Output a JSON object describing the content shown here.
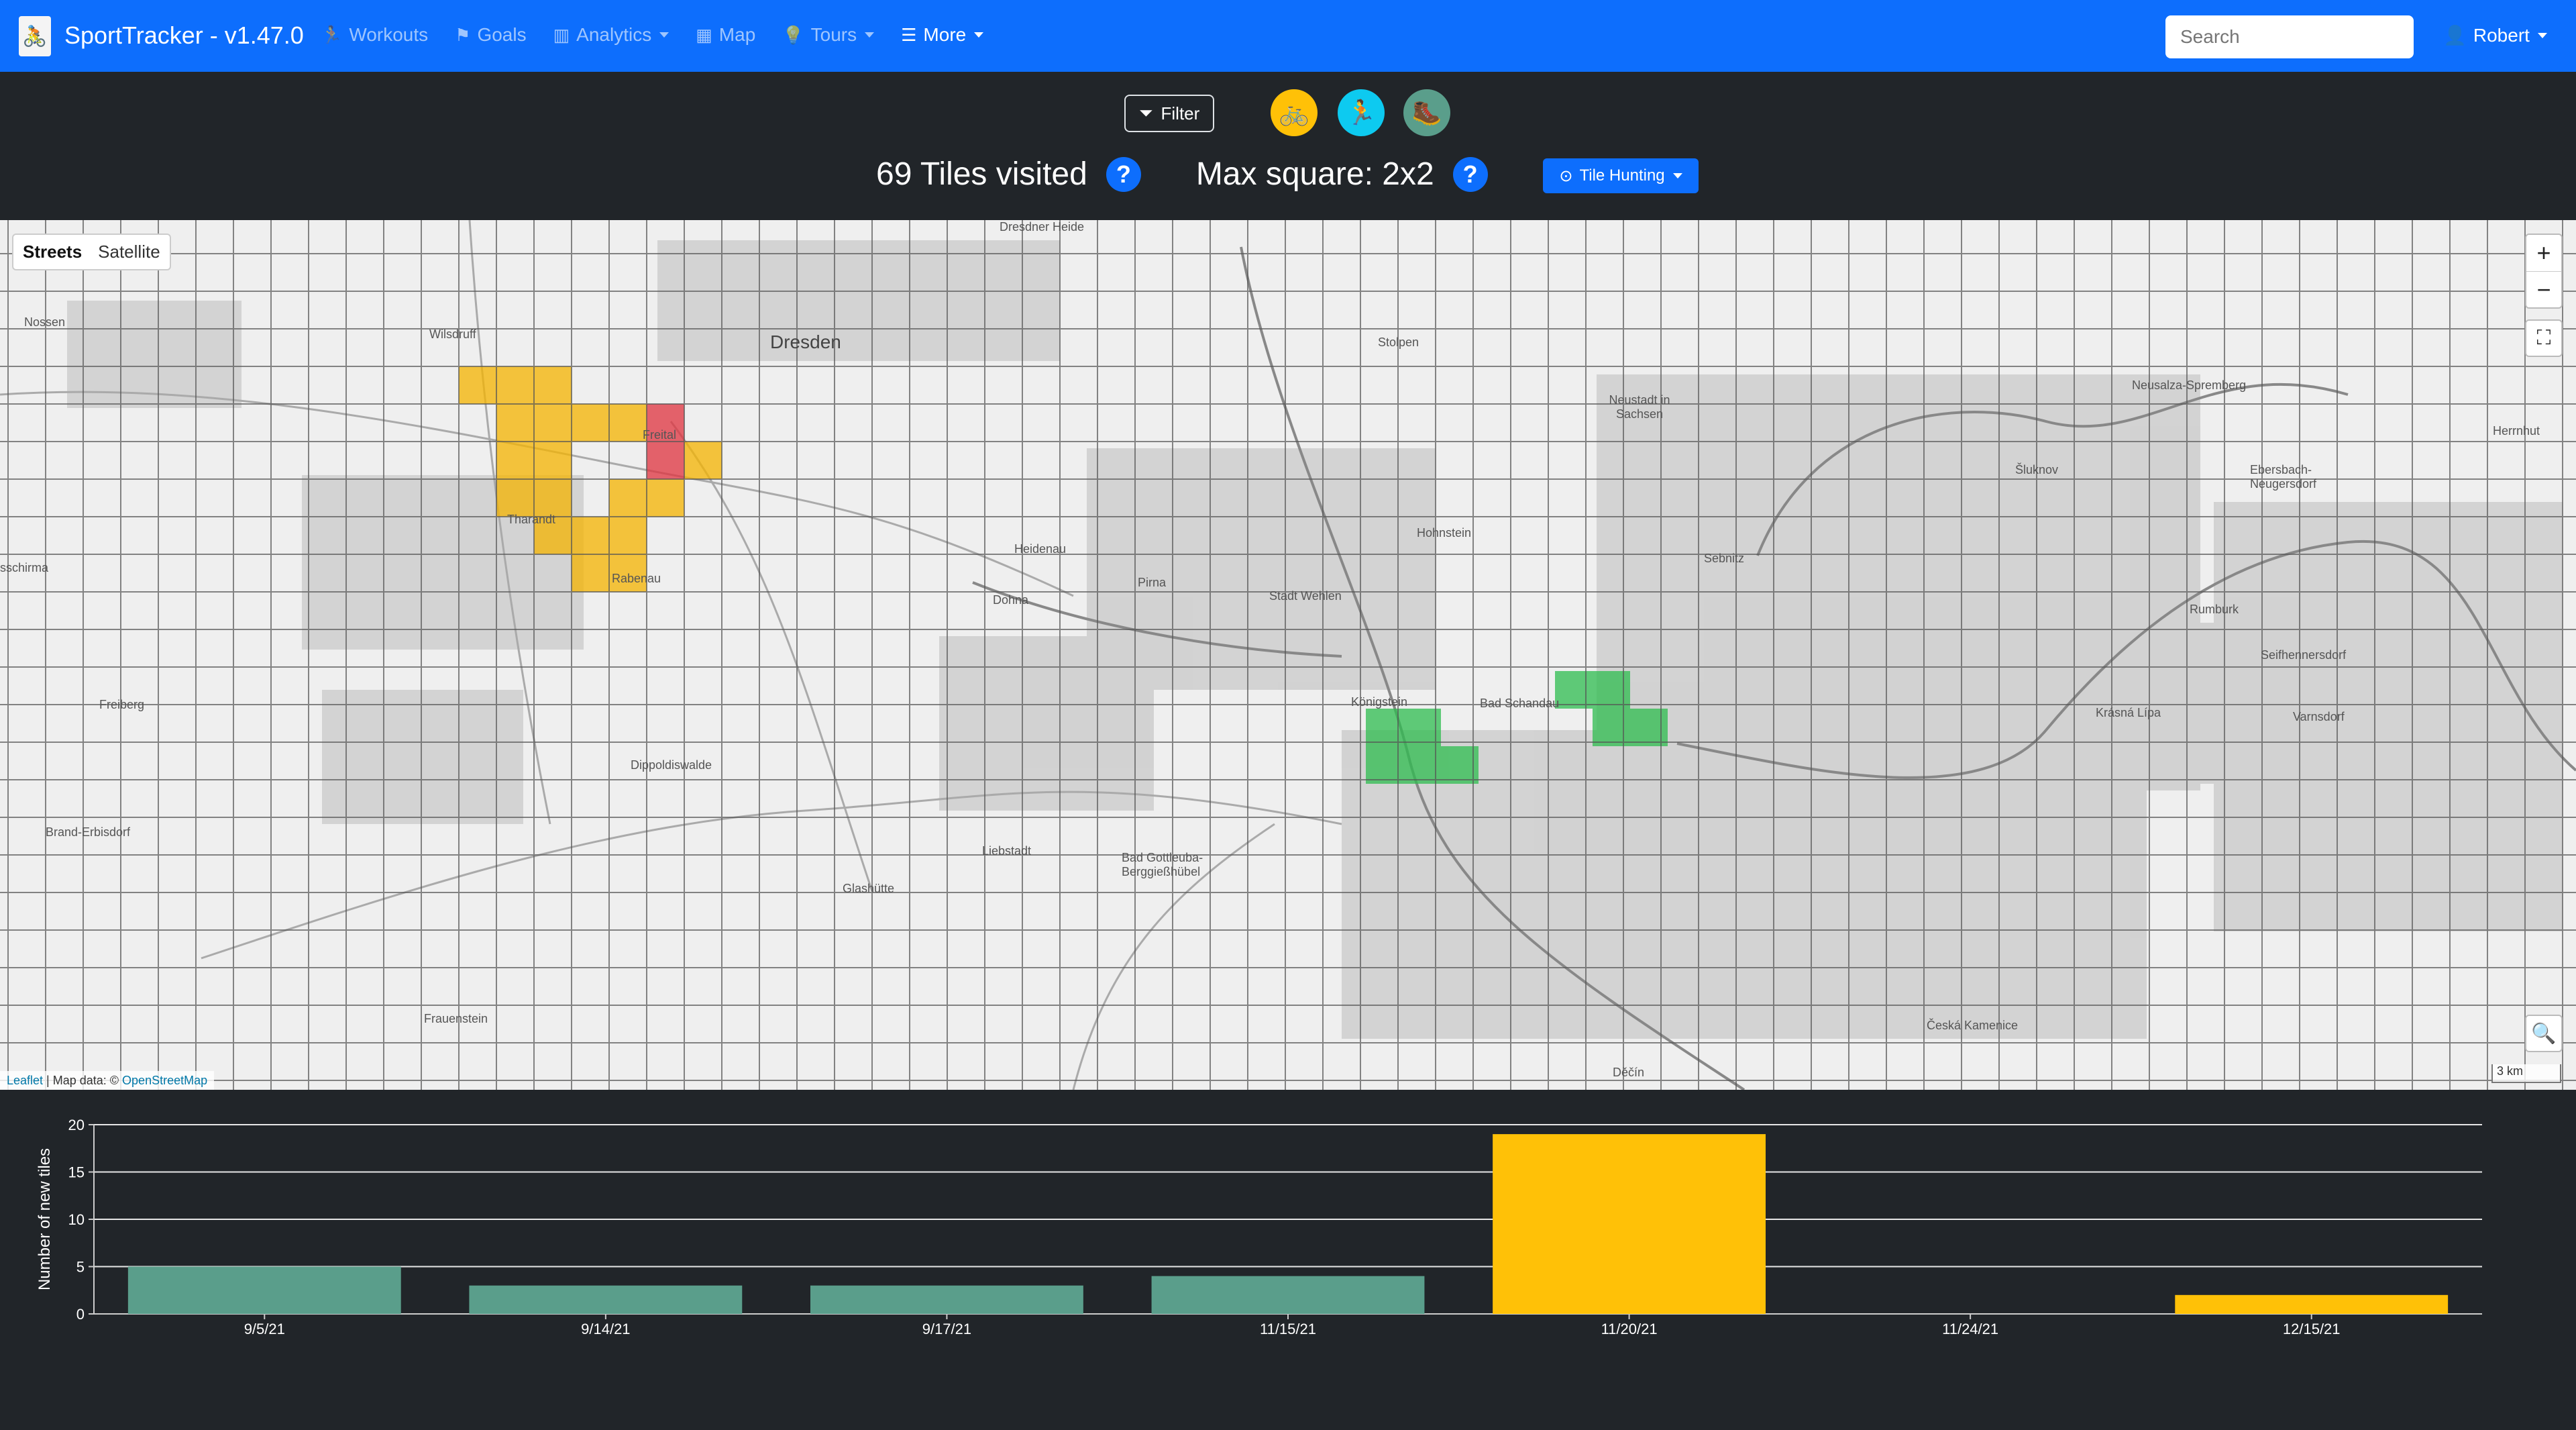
{
  "navbar": {
    "brand": "SportTracker - v1.47.0",
    "items": [
      {
        "label": "Workouts",
        "icon": "running-icon"
      },
      {
        "label": "Goals",
        "icon": "flag-icon"
      },
      {
        "label": "Analytics",
        "icon": "bar-chart-icon",
        "dropdown": true
      },
      {
        "label": "Map",
        "icon": "map-icon"
      },
      {
        "label": "Tours",
        "icon": "lightbulb-icon",
        "dropdown": true
      },
      {
        "label": "More",
        "icon": "list-icon",
        "dropdown": true
      }
    ],
    "search_placeholder": "Search",
    "user": "Robert"
  },
  "controls": {
    "filter_label": "Filter",
    "sports": [
      {
        "name": "cycling",
        "color": "#ffc107"
      },
      {
        "name": "running",
        "color": "#0dcaf0"
      },
      {
        "name": "hiking",
        "color": "#5a9e8b"
      }
    ],
    "tiles_visited": "69 Tiles visited",
    "max_square": "Max square: 2x2",
    "help": "?",
    "tile_hunting_label": "Tile Hunting"
  },
  "map": {
    "layers": {
      "streets": "Streets",
      "satellite": "Satellite"
    },
    "zoom_in": "+",
    "zoom_out": "−",
    "scale": "3 km",
    "attribution_leaflet": "Leaflet",
    "attribution_text": " | Map data: © ",
    "attribution_osm": "OpenStreetMap",
    "places": [
      {
        "name": "Dresden",
        "city": true
      },
      {
        "name": "Dresdner Heide"
      },
      {
        "name": "Nossen"
      },
      {
        "name": "Wilsdruff"
      },
      {
        "name": "Freital"
      },
      {
        "name": "Tharandt"
      },
      {
        "name": "Rabenau"
      },
      {
        "name": "Heidenau"
      },
      {
        "name": "Pirna"
      },
      {
        "name": "Dohna"
      },
      {
        "name": "Stolpen"
      },
      {
        "name": "Neustadt in Sachsen"
      },
      {
        "name": "Hohnstein"
      },
      {
        "name": "Stadt Wehlen"
      },
      {
        "name": "Sebnitz"
      },
      {
        "name": "Königstein"
      },
      {
        "name": "Bad Schandau"
      },
      {
        "name": "Freiberg"
      },
      {
        "name": "Dippoldiswalde"
      },
      {
        "name": "Brand-Erbisdorf"
      },
      {
        "name": "Liebstadt"
      },
      {
        "name": "Bad Gottleuba-Berggießhübel"
      },
      {
        "name": "Glashütte"
      },
      {
        "name": "Frauenstein"
      },
      {
        "name": "Neusalza-Spremberg"
      },
      {
        "name": "Šluknov"
      },
      {
        "name": "Ebersbach-Neugersdorf"
      },
      {
        "name": "Rumburk"
      },
      {
        "name": "Seifhennersdorf"
      },
      {
        "name": "Krásná Lípa"
      },
      {
        "name": "Varnsdorf"
      },
      {
        "name": "Česká Kamenice"
      },
      {
        "name": "Děčín"
      },
      {
        "name": "Herrnhut"
      },
      {
        "name": "sschirma"
      }
    ]
  },
  "chart_data": {
    "type": "bar",
    "categories": [
      "9/5/21",
      "9/14/21",
      "9/17/21",
      "11/15/21",
      "11/20/21",
      "11/24/21",
      "12/15/21"
    ],
    "values": [
      5,
      3,
      3,
      4,
      19,
      0,
      2
    ],
    "colors": [
      "#5a9e8b",
      "#5a9e8b",
      "#5a9e8b",
      "#5a9e8b",
      "#ffc107",
      "#5a9e8b",
      "#ffc107"
    ],
    "ylabel": "Number of new tiles",
    "ylim": [
      0,
      20
    ],
    "yticks": [
      0,
      5,
      10,
      15,
      20
    ],
    "grid": true
  }
}
